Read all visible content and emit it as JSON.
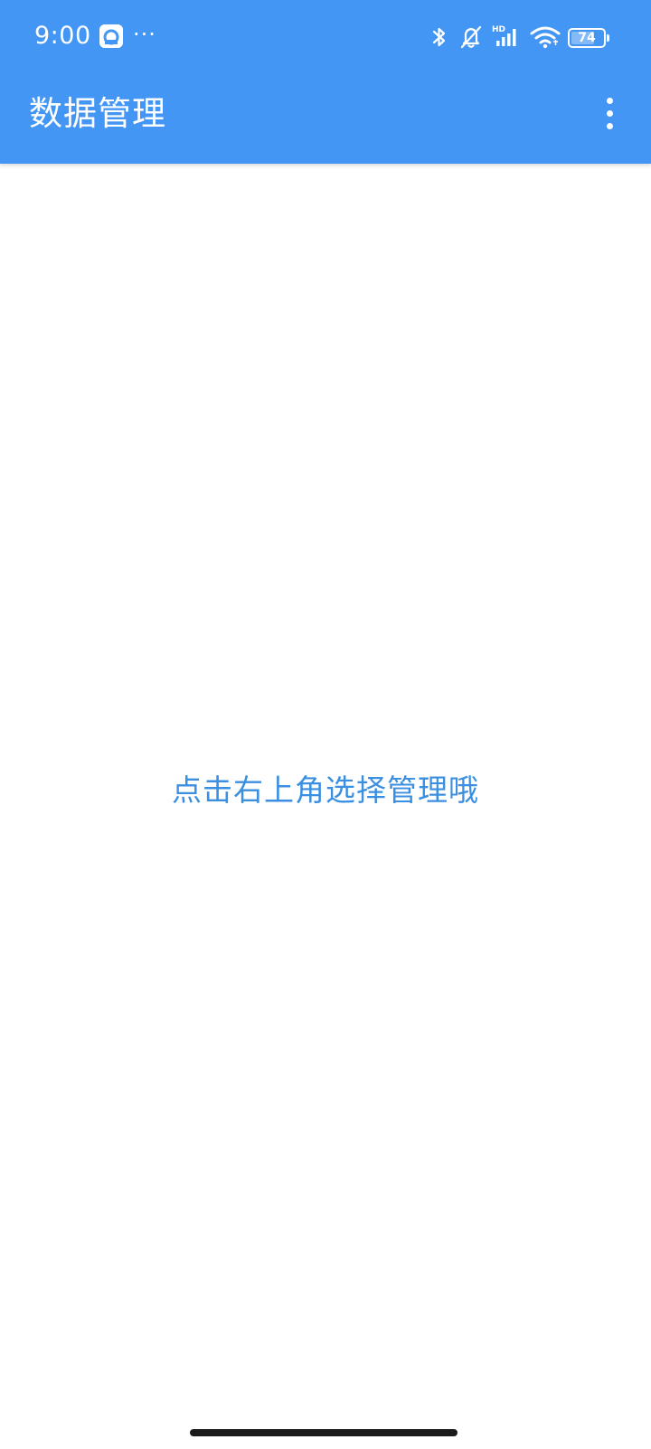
{
  "status_bar": {
    "time": "9:00",
    "more": "···",
    "battery_level": "74",
    "battery_fraction": 0.74,
    "icons": [
      "app-notification-icon",
      "bluetooth-icon",
      "mute-bell-icon",
      "hd-signal-icon",
      "wifi-icon",
      "battery-icon"
    ]
  },
  "toolbar": {
    "title": "数据管理",
    "menu_icon": "overflow-menu-icon"
  },
  "content": {
    "empty_hint": "点击右上角选择管理哦"
  },
  "colors": {
    "primary": "#4496F5",
    "hint_text": "#3B8FE0",
    "background": "#ffffff"
  }
}
